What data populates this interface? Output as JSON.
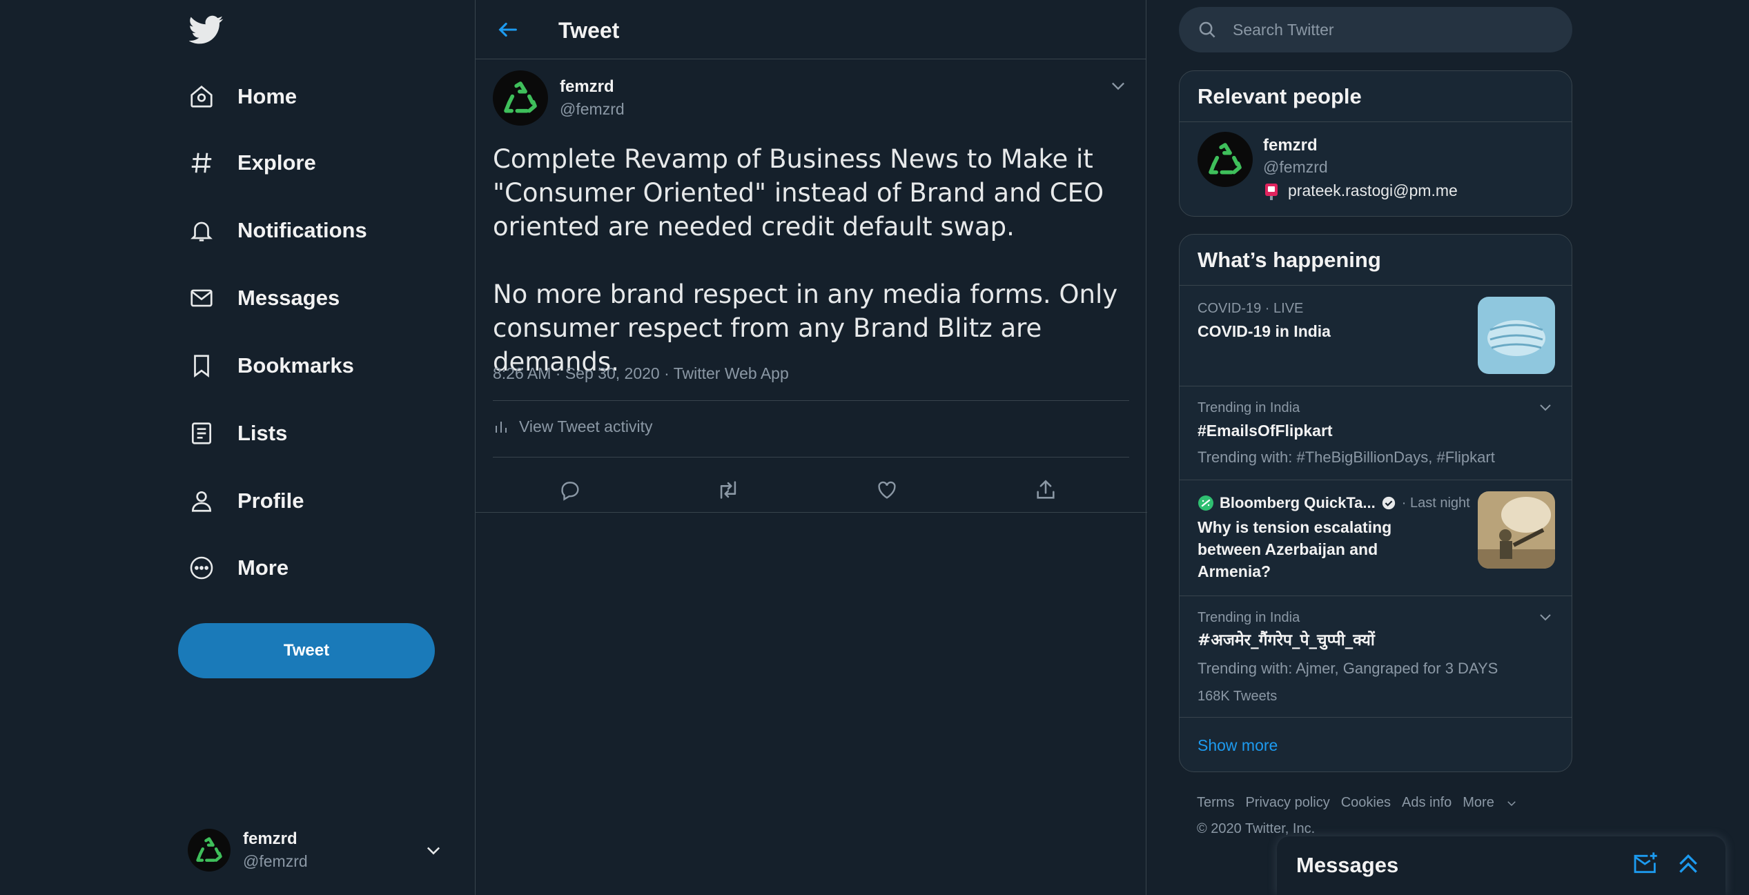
{
  "colors": {
    "background": "#15202b",
    "accent": "#1d9bf0",
    "tweet_button": "#1a7ab9",
    "border": "#38444d",
    "card": "#192734",
    "muted": "#8b98a5",
    "avatar_green": "#3fbf5b"
  },
  "sidebar": {
    "logo_icon": "twitter-bird-icon",
    "nav": [
      {
        "label": "Home",
        "icon": "home-icon"
      },
      {
        "label": "Explore",
        "icon": "hashtag-icon"
      },
      {
        "label": "Notifications",
        "icon": "bell-icon"
      },
      {
        "label": "Messages",
        "icon": "envelope-icon"
      },
      {
        "label": "Bookmarks",
        "icon": "bookmark-icon"
      },
      {
        "label": "Lists",
        "icon": "list-icon"
      },
      {
        "label": "Profile",
        "icon": "person-icon"
      },
      {
        "label": "More",
        "icon": "more-circle-icon"
      }
    ],
    "tweet_button": "Tweet",
    "account": {
      "name": "femzrd",
      "handle": "@femzrd",
      "avatar_icon": "recycle-icon"
    }
  },
  "main": {
    "header_title": "Tweet",
    "tweet": {
      "author_name": "femzrd",
      "author_handle": "@femzrd",
      "paragraphs": [
        "Complete Revamp of Business News to Make it \"Consumer Oriented\" instead of Brand and CEO oriented are needed credit default swap.",
        "No more brand respect in any media forms. Only consumer respect from any Brand Blitz are demands."
      ],
      "time": "8:26 AM",
      "date": "Sep 30, 2020",
      "source": "Twitter Web App",
      "activity_label": "View Tweet activity"
    }
  },
  "right": {
    "search_placeholder": "Search Twitter",
    "relevant": {
      "title": "Relevant people",
      "name": "femzrd",
      "handle": "@femzrd",
      "bio": "prateek.rastogi@pm.me"
    },
    "happening": {
      "title": "What’s happening",
      "items": [
        {
          "context": "COVID-19 · LIVE",
          "title": "COVID-19 in India"
        },
        {
          "context": "Trending in India",
          "title": "#EmailsOfFlipkart",
          "sub": "Trending with: #TheBigBillionDays, #Flipkart"
        },
        {
          "source": "Bloomberg QuickTa...",
          "when": "· Last night",
          "title": "Why is tension escalating between Azerbaijan and Armenia?"
        },
        {
          "context": "Trending in India",
          "title": "#अजमेर_गैंगरेप_पे_चुप्पी_क्यों",
          "sub": "Trending with: Ajmer, Gangraped for 3 DAYS",
          "count": "168K Tweets"
        }
      ],
      "show_more": "Show more"
    },
    "footer": {
      "links": [
        "Terms",
        "Privacy policy",
        "Cookies",
        "Ads info",
        "More"
      ],
      "copyright": "© 2020 Twitter, Inc."
    }
  },
  "messages_drawer": {
    "title": "Messages"
  }
}
